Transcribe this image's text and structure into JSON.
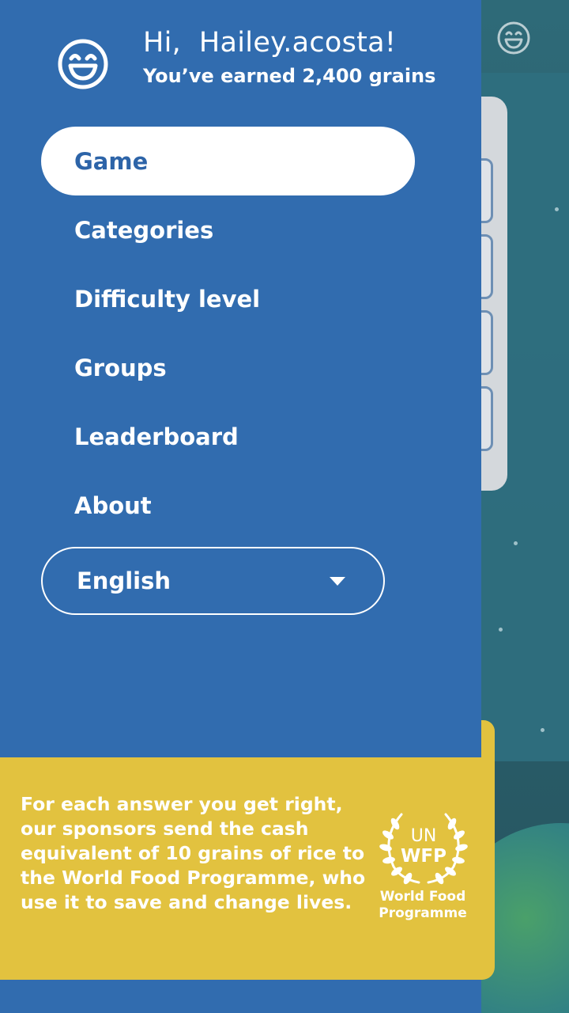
{
  "user": {
    "greeting": "Hi,  Hailey.acosta!",
    "earned": "You’ve earned 2,400 grains",
    "avatar_icon": "smiley-face-icon"
  },
  "menu": {
    "items": [
      {
        "label": "Game",
        "active": true
      },
      {
        "label": "Categories",
        "active": false
      },
      {
        "label": "Difficulty level",
        "active": false
      },
      {
        "label": "Groups",
        "active": false
      },
      {
        "label": "Leaderboard",
        "active": false
      },
      {
        "label": "About",
        "active": false
      }
    ]
  },
  "language": {
    "selected": "English",
    "icon": "chevron-down-icon"
  },
  "info": {
    "text": "For each answer you get right, our sponsors send the cash equivalent of 10 grains of rice to the World Food Programme, who use it to save and change lives.",
    "logo_lines": [
      "UN",
      "WFP"
    ],
    "org_line1": "World Food",
    "org_line2": "Programme"
  },
  "colors": {
    "drawer_bg": "#316caf",
    "active_item_text": "#2d64a8",
    "info_bg": "#e2c23f",
    "text": "#ffffff"
  }
}
